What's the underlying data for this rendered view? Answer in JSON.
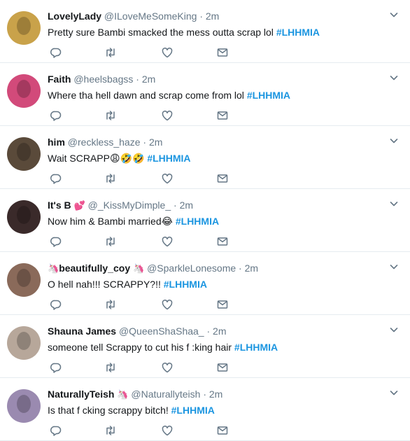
{
  "icons": {
    "reply": "reply-icon",
    "retweet": "retweet-icon",
    "like": "heart-icon",
    "dm": "envelope-icon",
    "menu": "chevron-down-icon"
  },
  "colors": {
    "hashtag": "#1b95e0",
    "secondary_text": "#657786",
    "divider": "#e6ecf0",
    "icon": "#657786"
  },
  "tweets": [
    {
      "name": "LovelyLady",
      "handle": "@ILoveMeSomeKing",
      "separator": "·",
      "time": "2m",
      "text": "Pretty sure Bambi smacked the mess outta scrap lol",
      "emoji": "",
      "hashtag": "#LHHMIA",
      "avatar_color": "#c9a24a"
    },
    {
      "name": "Faith",
      "handle": "@heelsbagss",
      "separator": "·",
      "time": "2m",
      "text": "Where tha hell dawn and scrap come from lol",
      "emoji": "",
      "hashtag": "#LHHMIA",
      "avatar_color": "#d24a7a"
    },
    {
      "name": "him",
      "handle": "@reckless_haze",
      "separator": "·",
      "time": "2m",
      "text": "Wait SCRAPP",
      "emoji": "😩🤣🤣",
      "hashtag": "#LHHMIA",
      "avatar_color": "#5a4a3a"
    },
    {
      "name": "It's B",
      "name_emoji": "💕",
      "handle": "@_KissMyDimple_",
      "separator": "·",
      "time": "2m",
      "text": "Now him & Bambi married",
      "emoji": "😂",
      "hashtag": "#LHHMIA",
      "avatar_color": "#3a2a2a"
    },
    {
      "name": "beautifully_coy",
      "name_prefix_emoji": "🦄",
      "name_emoji": "🦄",
      "handle": "@SparkleLonesome",
      "separator": "·",
      "time": "2m",
      "text": "O hell nah!!! SCRAPPY?!!",
      "emoji": "",
      "hashtag": "#LHHMIA",
      "avatar_color": "#8a6a5a"
    },
    {
      "name": "Shauna James",
      "handle": "@QueenShaShaa_",
      "separator": "·",
      "time": "2m",
      "text": "someone tell Scrappy to cut his f  :king hair",
      "emoji": "",
      "hashtag": "#LHHMIA",
      "avatar_color": "#b7a79a"
    },
    {
      "name": "NaturallyTeish",
      "name_emoji": "🦄",
      "handle": "@Naturallyteish",
      "separator": "·",
      "time": "2m",
      "text": "Is that f  cking scrappy bitch!",
      "emoji": "",
      "hashtag": "#LHHMIA",
      "avatar_color": "#9a8ab0"
    }
  ]
}
